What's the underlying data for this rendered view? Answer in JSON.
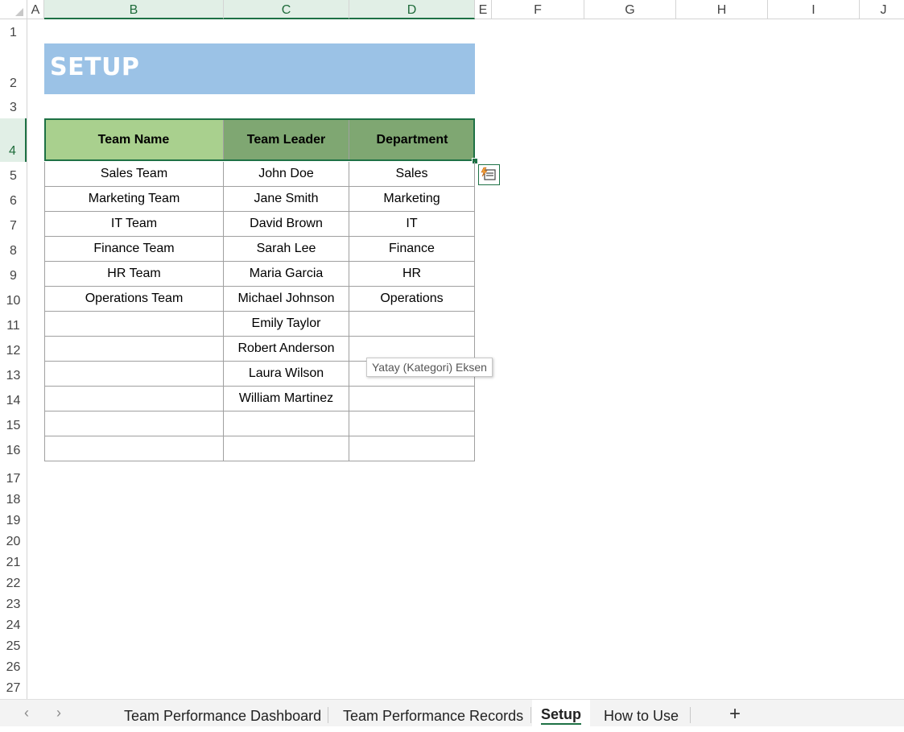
{
  "columns": [
    "A",
    "B",
    "C",
    "D",
    "E",
    "F",
    "G",
    "H",
    "I",
    "J"
  ],
  "rows": [
    "1",
    "2",
    "3",
    "4",
    "5",
    "6",
    "7",
    "8",
    "9",
    "10",
    "11",
    "12",
    "13",
    "14",
    "15",
    "16",
    "17",
    "18",
    "19",
    "20",
    "21",
    "22",
    "23",
    "24",
    "25",
    "26",
    "27"
  ],
  "title": "SETUP",
  "table": {
    "headers": [
      "Team Name",
      "Team Leader",
      "Department"
    ],
    "rows": [
      [
        "Sales Team",
        "John Doe",
        "Sales"
      ],
      [
        "Marketing Team",
        "Jane Smith",
        "Marketing"
      ],
      [
        "IT Team",
        "David Brown",
        "IT"
      ],
      [
        "Finance Team",
        "Sarah Lee",
        "Finance"
      ],
      [
        "HR Team",
        "Maria Garcia",
        "HR"
      ],
      [
        "Operations Team",
        "Michael Johnson",
        "Operations"
      ],
      [
        "",
        "Emily Taylor",
        ""
      ],
      [
        "",
        "Robert Anderson",
        ""
      ],
      [
        "",
        "Laura Wilson",
        ""
      ],
      [
        "",
        "William Martinez",
        ""
      ],
      [
        "",
        "",
        ""
      ],
      [
        "",
        "",
        ""
      ]
    ]
  },
  "tooltip": "Yatay (Kategori) Eksen",
  "sheet_tabs": [
    {
      "label": "Team Performance Dashboard",
      "active": false
    },
    {
      "label": "Team Performance Records",
      "active": false
    },
    {
      "label": "Setup",
      "active": true
    },
    {
      "label": "How to Use",
      "active": false
    }
  ],
  "add_sheet_label": "+",
  "nav": {
    "prev": "‹",
    "next": "›"
  },
  "colors": {
    "title_bg": "#9bc2e6",
    "header_name_bg": "#a9d08e",
    "header_other_bg": "#7fa772",
    "selection": "#1e7145"
  },
  "icons": [
    "quick-analysis-icon",
    "select-all-corner-icon"
  ]
}
